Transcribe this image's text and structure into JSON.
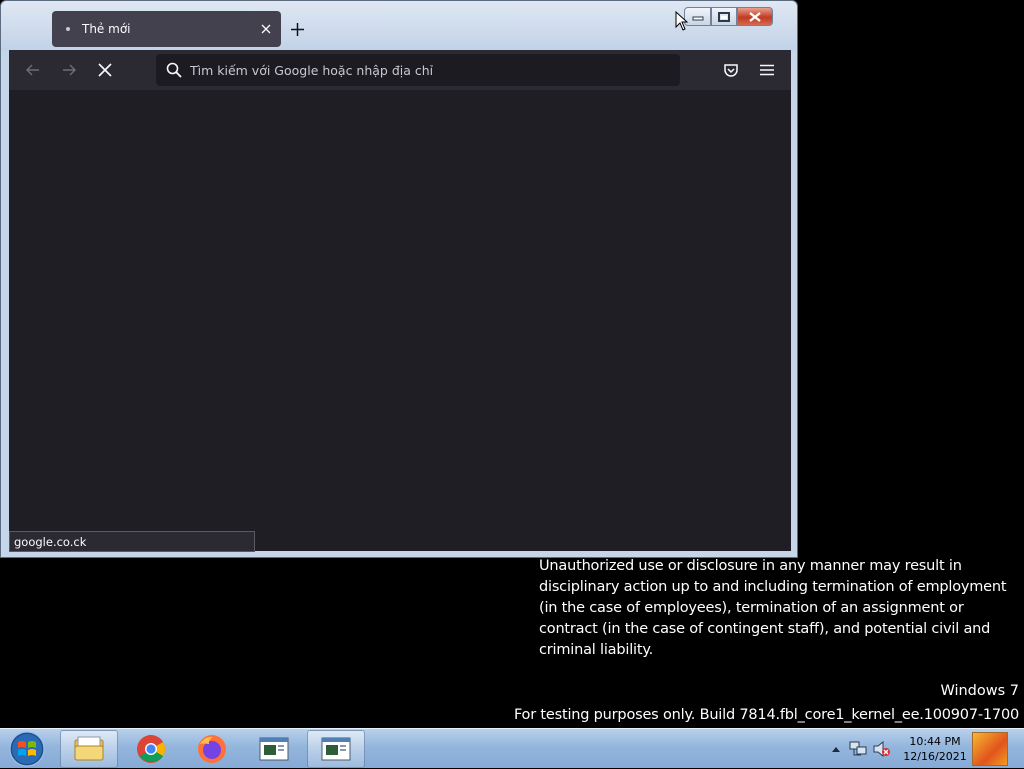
{
  "browser": {
    "tab": {
      "title": "Thẻ mới",
      "favicon": "firefox-dot-icon",
      "close_icon": "close-icon"
    },
    "new_tab_icon": "plus-icon",
    "nav": {
      "back_icon": "arrow-left-icon",
      "forward_icon": "arrow-right-icon",
      "stop_icon": "stop-x-icon",
      "pocket_icon": "pocket-icon",
      "menu_icon": "hamburger-icon"
    },
    "urlbar": {
      "placeholder": "Tìm kiếm với Google hoặc nhập địa chỉ",
      "value": ""
    },
    "status_text": "google.co.ck",
    "colors": {
      "toolbar": "#2b2a33",
      "content": "#1f1e25",
      "tab_active": "#42414d",
      "urlbar": "#1c1b22"
    }
  },
  "desktop": {
    "legal_text": "Unauthorized use or disclosure in any manner may result in disciplinary action up to and including termination of employment (in the case of employees), termination of an assignment or contract (in the case of contingent staff), and potential civil and criminal liability.",
    "windows_version": "Windows 7",
    "build_text": "For testing purposes only. Build 7814.fbl_core1_kernel_ee.100907-1700"
  },
  "taskbar": {
    "start_icon": "windows-start-icon",
    "items": [
      {
        "name": "explorer",
        "icon": "folder-icon"
      },
      {
        "name": "chrome",
        "icon": "chrome-icon"
      },
      {
        "name": "firefox",
        "icon": "firefox-icon"
      },
      {
        "name": "window-1",
        "icon": "app-window-icon"
      },
      {
        "name": "window-2",
        "icon": "app-window-icon"
      }
    ],
    "clock": {
      "time": "10:44 PM",
      "date": "12/16/2021"
    }
  }
}
